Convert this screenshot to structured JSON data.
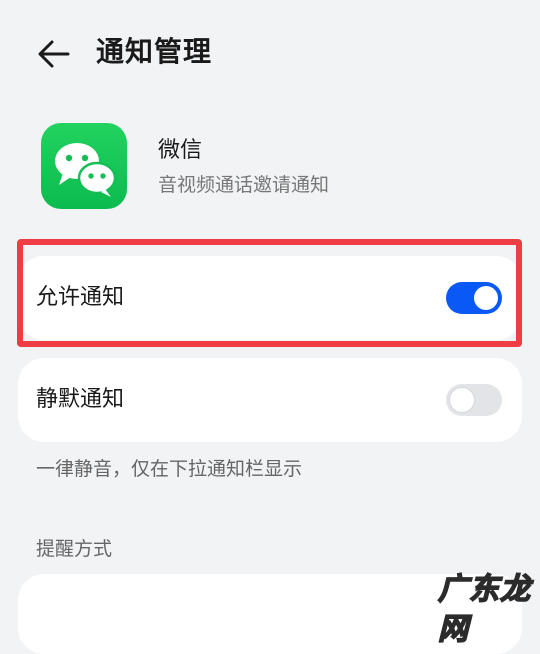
{
  "header": {
    "back_icon": "arrow-left-icon",
    "title": "通知管理"
  },
  "app": {
    "icon": "wechat-icon",
    "icon_color": "#1ec85a",
    "name": "微信",
    "description": "音视频通话邀请通知"
  },
  "settings": {
    "allow_notifications": {
      "label": "允许通知",
      "enabled": true
    },
    "silent_notifications": {
      "label": "静默通知",
      "enabled": false
    },
    "silent_hint": "一律静音，仅在下拉通知栏显示"
  },
  "reminder_section": {
    "title": "提醒方式"
  },
  "colors": {
    "accent": "#0a59f7",
    "highlight": "#f03c45",
    "background": "#f1f3f5"
  },
  "watermark": {
    "text": "广东龙网"
  }
}
